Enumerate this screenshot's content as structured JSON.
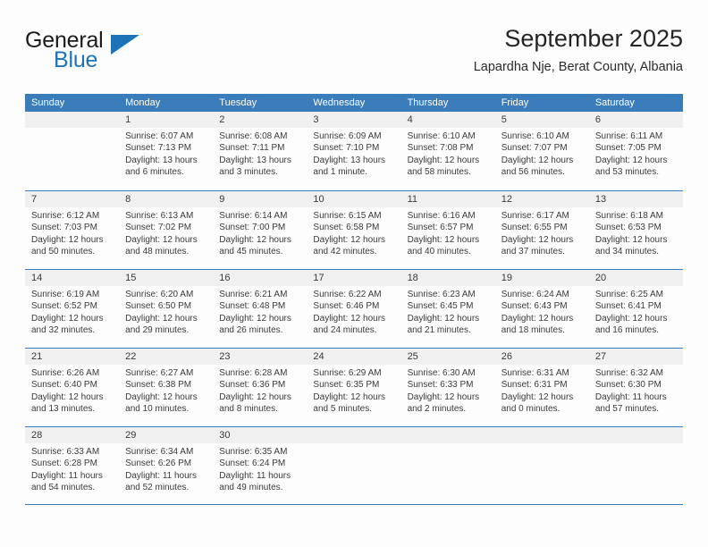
{
  "brand": {
    "name_top": "General",
    "name_bottom": "Blue",
    "accent_color": "#1c73b8"
  },
  "header": {
    "title": "September 2025",
    "subtitle": "Lapardha Nje, Berat County, Albania"
  },
  "calendar": {
    "header_color": "#3b7cba",
    "daynum_band_color": "#f0f0f0",
    "weekdays": [
      "Sunday",
      "Monday",
      "Tuesday",
      "Wednesday",
      "Thursday",
      "Friday",
      "Saturday"
    ],
    "weeks": [
      [
        {
          "day": "",
          "lines": []
        },
        {
          "day": "1",
          "lines": [
            "Sunrise: 6:07 AM",
            "Sunset: 7:13 PM",
            "Daylight: 13 hours",
            "and 6 minutes."
          ]
        },
        {
          "day": "2",
          "lines": [
            "Sunrise: 6:08 AM",
            "Sunset: 7:11 PM",
            "Daylight: 13 hours",
            "and 3 minutes."
          ]
        },
        {
          "day": "3",
          "lines": [
            "Sunrise: 6:09 AM",
            "Sunset: 7:10 PM",
            "Daylight: 13 hours",
            "and 1 minute."
          ]
        },
        {
          "day": "4",
          "lines": [
            "Sunrise: 6:10 AM",
            "Sunset: 7:08 PM",
            "Daylight: 12 hours",
            "and 58 minutes."
          ]
        },
        {
          "day": "5",
          "lines": [
            "Sunrise: 6:10 AM",
            "Sunset: 7:07 PM",
            "Daylight: 12 hours",
            "and 56 minutes."
          ]
        },
        {
          "day": "6",
          "lines": [
            "Sunrise: 6:11 AM",
            "Sunset: 7:05 PM",
            "Daylight: 12 hours",
            "and 53 minutes."
          ]
        }
      ],
      [
        {
          "day": "7",
          "lines": [
            "Sunrise: 6:12 AM",
            "Sunset: 7:03 PM",
            "Daylight: 12 hours",
            "and 50 minutes."
          ]
        },
        {
          "day": "8",
          "lines": [
            "Sunrise: 6:13 AM",
            "Sunset: 7:02 PM",
            "Daylight: 12 hours",
            "and 48 minutes."
          ]
        },
        {
          "day": "9",
          "lines": [
            "Sunrise: 6:14 AM",
            "Sunset: 7:00 PM",
            "Daylight: 12 hours",
            "and 45 minutes."
          ]
        },
        {
          "day": "10",
          "lines": [
            "Sunrise: 6:15 AM",
            "Sunset: 6:58 PM",
            "Daylight: 12 hours",
            "and 42 minutes."
          ]
        },
        {
          "day": "11",
          "lines": [
            "Sunrise: 6:16 AM",
            "Sunset: 6:57 PM",
            "Daylight: 12 hours",
            "and 40 minutes."
          ]
        },
        {
          "day": "12",
          "lines": [
            "Sunrise: 6:17 AM",
            "Sunset: 6:55 PM",
            "Daylight: 12 hours",
            "and 37 minutes."
          ]
        },
        {
          "day": "13",
          "lines": [
            "Sunrise: 6:18 AM",
            "Sunset: 6:53 PM",
            "Daylight: 12 hours",
            "and 34 minutes."
          ]
        }
      ],
      [
        {
          "day": "14",
          "lines": [
            "Sunrise: 6:19 AM",
            "Sunset: 6:52 PM",
            "Daylight: 12 hours",
            "and 32 minutes."
          ]
        },
        {
          "day": "15",
          "lines": [
            "Sunrise: 6:20 AM",
            "Sunset: 6:50 PM",
            "Daylight: 12 hours",
            "and 29 minutes."
          ]
        },
        {
          "day": "16",
          "lines": [
            "Sunrise: 6:21 AM",
            "Sunset: 6:48 PM",
            "Daylight: 12 hours",
            "and 26 minutes."
          ]
        },
        {
          "day": "17",
          "lines": [
            "Sunrise: 6:22 AM",
            "Sunset: 6:46 PM",
            "Daylight: 12 hours",
            "and 24 minutes."
          ]
        },
        {
          "day": "18",
          "lines": [
            "Sunrise: 6:23 AM",
            "Sunset: 6:45 PM",
            "Daylight: 12 hours",
            "and 21 minutes."
          ]
        },
        {
          "day": "19",
          "lines": [
            "Sunrise: 6:24 AM",
            "Sunset: 6:43 PM",
            "Daylight: 12 hours",
            "and 18 minutes."
          ]
        },
        {
          "day": "20",
          "lines": [
            "Sunrise: 6:25 AM",
            "Sunset: 6:41 PM",
            "Daylight: 12 hours",
            "and 16 minutes."
          ]
        }
      ],
      [
        {
          "day": "21",
          "lines": [
            "Sunrise: 6:26 AM",
            "Sunset: 6:40 PM",
            "Daylight: 12 hours",
            "and 13 minutes."
          ]
        },
        {
          "day": "22",
          "lines": [
            "Sunrise: 6:27 AM",
            "Sunset: 6:38 PM",
            "Daylight: 12 hours",
            "and 10 minutes."
          ]
        },
        {
          "day": "23",
          "lines": [
            "Sunrise: 6:28 AM",
            "Sunset: 6:36 PM",
            "Daylight: 12 hours",
            "and 8 minutes."
          ]
        },
        {
          "day": "24",
          "lines": [
            "Sunrise: 6:29 AM",
            "Sunset: 6:35 PM",
            "Daylight: 12 hours",
            "and 5 minutes."
          ]
        },
        {
          "day": "25",
          "lines": [
            "Sunrise: 6:30 AM",
            "Sunset: 6:33 PM",
            "Daylight: 12 hours",
            "and 2 minutes."
          ]
        },
        {
          "day": "26",
          "lines": [
            "Sunrise: 6:31 AM",
            "Sunset: 6:31 PM",
            "Daylight: 12 hours",
            "and 0 minutes."
          ]
        },
        {
          "day": "27",
          "lines": [
            "Sunrise: 6:32 AM",
            "Sunset: 6:30 PM",
            "Daylight: 11 hours",
            "and 57 minutes."
          ]
        }
      ],
      [
        {
          "day": "28",
          "lines": [
            "Sunrise: 6:33 AM",
            "Sunset: 6:28 PM",
            "Daylight: 11 hours",
            "and 54 minutes."
          ]
        },
        {
          "day": "29",
          "lines": [
            "Sunrise: 6:34 AM",
            "Sunset: 6:26 PM",
            "Daylight: 11 hours",
            "and 52 minutes."
          ]
        },
        {
          "day": "30",
          "lines": [
            "Sunrise: 6:35 AM",
            "Sunset: 6:24 PM",
            "Daylight: 11 hours",
            "and 49 minutes."
          ]
        },
        {
          "day": "",
          "lines": []
        },
        {
          "day": "",
          "lines": []
        },
        {
          "day": "",
          "lines": []
        },
        {
          "day": "",
          "lines": []
        }
      ]
    ]
  }
}
